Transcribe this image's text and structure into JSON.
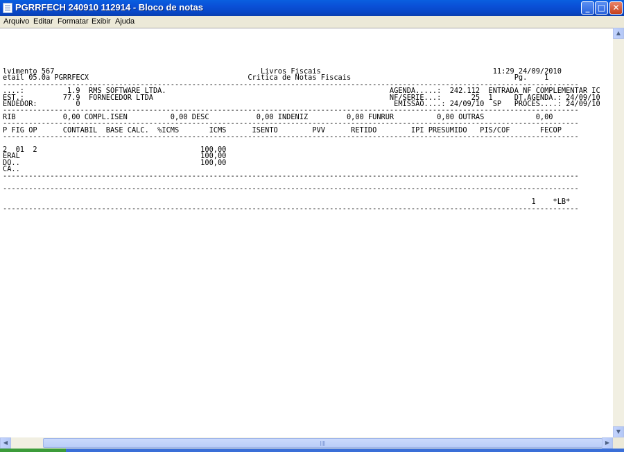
{
  "window": {
    "title": "PGRRFECH 240910 112914 - Bloco de notas",
    "minimize_label": "_",
    "maximize_label": "□",
    "close_label": "✕"
  },
  "menu": {
    "arquivo": "Arquivo",
    "editar": "Editar",
    "formatar": "Formatar",
    "exibir": "Exibir",
    "ajuda": "Ajuda"
  },
  "document": {
    "text": "lvimento 567                                                Livros Fiscais                                        11:29 24/09/2010\netail 05.0a PGRRFECX                                     Critica de Notas Fiscais                                      Pg.    1\n--------------------------------------------------------------------------------------------------------------------------------------\n....:          1.9  RMS SOFTWARE LTDA.                                                    AGENDA.....:  242.112  ENTRADA NF COMPLEMENTAR IC\nEST.:         77.9  FORNECEDOR LTDA                                                       NF/SERIE...:       25  1     DT.AGENDA.: 24/09/10\nENDEDOR:         0                                                                         EMISSAO....: 24/09/10  SP   PROCES....: 24/09/10\n--------------------------------------------------------------------------------------------------------------------------------------\nRIB           0,00 COMPL.ISEN          0,00 DESC           0,00 INDENIZ         0,00 FUNRUR          0,00 OUTRAS            0,00\n--------------------------------------------------------------------------------------------------------------------------------------\nP FIG OP      CONTABIL  BASE CALC.  %ICMS       ICMS      ISENTO        PVV      RETIDO        IPI PRESUMIDO   PIS/COF       FECOP\n--------------------------------------------------------------------------------------------------------------------------------------\n\n2  01  2                                      100,00\nERAL                                          100,00\nDO..                                          100,00\nCA..\n--------------------------------------------------------------------------------------------------------------------------------------\n\n--------------------------------------------------------------------------------------------------------------------------------------\n\n                                                                                                                           1    *LB*\n--------------------------------------------------------------------------------------------------------------------------------------"
  },
  "scrollbars": {
    "up_arrow": "▲",
    "down_arrow": "▼",
    "left_arrow": "◀",
    "right_arrow": "▶"
  }
}
